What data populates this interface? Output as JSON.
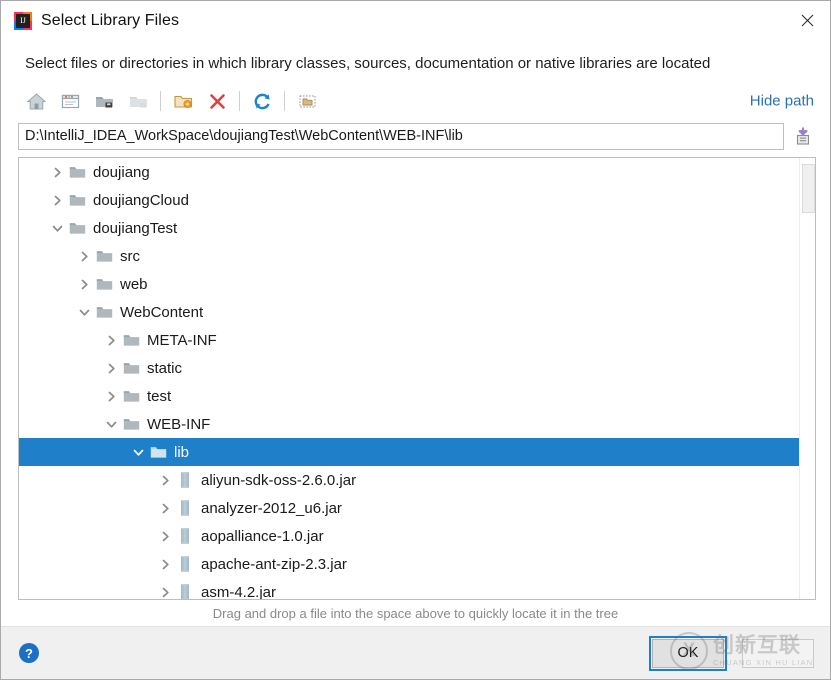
{
  "window": {
    "title": "Select Library Files",
    "app_icon": "intellij-idea-icon",
    "close_label": "✕"
  },
  "description": "Select files or directories in which library classes, sources, documentation or native libraries are located",
  "toolbar": {
    "buttons": [
      {
        "name": "home-icon",
        "tooltip": "Home"
      },
      {
        "name": "desktop-icon",
        "tooltip": "Desktop"
      },
      {
        "name": "project-folder-icon",
        "tooltip": "Project"
      },
      {
        "name": "module-folder-icon",
        "tooltip": "Module"
      },
      {
        "name": "new-folder-icon",
        "tooltip": "New Folder"
      },
      {
        "name": "delete-icon",
        "tooltip": "Delete"
      },
      {
        "name": "refresh-icon",
        "tooltip": "Refresh"
      },
      {
        "name": "show-hidden-files-icon",
        "tooltip": "Show Hidden Files and Directories"
      }
    ],
    "hide_path_label": "Hide path"
  },
  "path": {
    "value": "D:\\IntelliJ_IDEA_WorkSpace\\doujiangTest\\WebContent\\WEB-INF\\lib",
    "placeholder": "",
    "paste_icon": "paste-from-clipboard-icon"
  },
  "tree": {
    "rows": [
      {
        "label": "doujiang",
        "indent": 1,
        "state": "collapsed",
        "icon": "folder-icon",
        "selected": false
      },
      {
        "label": "doujiangCloud",
        "indent": 1,
        "state": "collapsed",
        "icon": "folder-icon",
        "selected": false
      },
      {
        "label": "doujiangTest",
        "indent": 1,
        "state": "expanded",
        "icon": "folder-icon",
        "selected": false
      },
      {
        "label": "src",
        "indent": 2,
        "state": "collapsed",
        "icon": "folder-icon",
        "selected": false
      },
      {
        "label": "web",
        "indent": 2,
        "state": "collapsed",
        "icon": "folder-icon",
        "selected": false
      },
      {
        "label": "WebContent",
        "indent": 2,
        "state": "expanded",
        "icon": "folder-icon",
        "selected": false
      },
      {
        "label": "META-INF",
        "indent": 3,
        "state": "collapsed",
        "icon": "folder-icon",
        "selected": false
      },
      {
        "label": "static",
        "indent": 3,
        "state": "collapsed",
        "icon": "folder-icon",
        "selected": false
      },
      {
        "label": "test",
        "indent": 3,
        "state": "collapsed",
        "icon": "folder-icon",
        "selected": false
      },
      {
        "label": "WEB-INF",
        "indent": 3,
        "state": "expanded",
        "icon": "folder-icon",
        "selected": false
      },
      {
        "label": "lib",
        "indent": 4,
        "state": "expanded",
        "icon": "folder-icon",
        "selected": true
      },
      {
        "label": "aliyun-sdk-oss-2.6.0.jar",
        "indent": 5,
        "state": "collapsed",
        "icon": "jar-icon",
        "selected": false
      },
      {
        "label": "analyzer-2012_u6.jar",
        "indent": 5,
        "state": "collapsed",
        "icon": "jar-icon",
        "selected": false
      },
      {
        "label": "aopalliance-1.0.jar",
        "indent": 5,
        "state": "collapsed",
        "icon": "jar-icon",
        "selected": false
      },
      {
        "label": "apache-ant-zip-2.3.jar",
        "indent": 5,
        "state": "collapsed",
        "icon": "jar-icon",
        "selected": false
      },
      {
        "label": "asm-4.2.jar",
        "indent": 5,
        "state": "collapsed",
        "icon": "jar-icon",
        "selected": false
      }
    ],
    "scrollbar": {
      "name": "vertical-scrollbar"
    }
  },
  "hint": "Drag and drop a file into the space above to quickly locate it in the tree",
  "footer": {
    "help_label": "?",
    "ok_label": "OK",
    "cancel_label": ""
  },
  "watermark": {
    "mark": "X",
    "cn": "创新互联",
    "en": "CHUANG XIN HU LIAN"
  },
  "colors": {
    "selection_blue": "#1f7fc9",
    "link_blue": "#2b6fb5",
    "delete_red": "#e04040",
    "folder_gray": "#b0b8bd"
  }
}
